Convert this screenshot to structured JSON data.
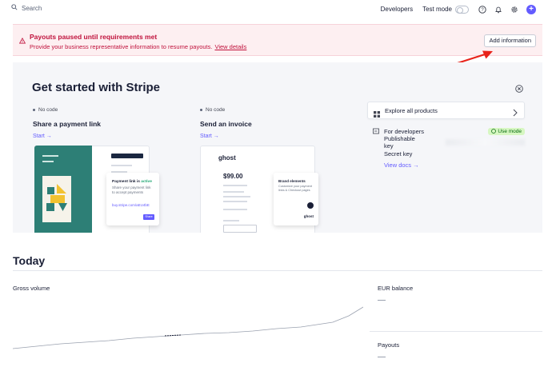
{
  "nav": {
    "search_placeholder": "Search",
    "developers": "Developers",
    "test_mode": "Test mode"
  },
  "alert": {
    "title": "Payouts paused until requirements met",
    "description": "Provide your business representative information to resume payouts.",
    "link": "View details",
    "button": "Add information"
  },
  "get_started": {
    "title": "Get started with Stripe",
    "cards": [
      {
        "tag": "No code",
        "title": "Share a payment link",
        "cta": "Start →"
      },
      {
        "tag": "No code",
        "title": "Send an invoice",
        "cta": "Start →"
      }
    ],
    "illus1": {
      "popup_title": "Payment link is",
      "popup_status": "active",
      "popup_text": "Share your payment link to accept payments",
      "popup_url": "buy.stripe.com/aEU4bE",
      "popup_btn": "Share"
    },
    "illus2": {
      "logo": "ghost",
      "amount": "$99.00",
      "popup_title": "Brand elements",
      "popup_text": "Customize your payment links & Checkout pages",
      "popup_logo": "ghost"
    },
    "explore": "Explore all products",
    "developers": {
      "label": "For developers",
      "badge": "Use mode",
      "publishable_key": "Publishable key",
      "secret_key": "Secret key",
      "docs": "View docs →"
    }
  },
  "today": {
    "title": "Today",
    "gross_volume": "Gross volume",
    "eur_balance": "EUR balance",
    "payouts": "Payouts"
  },
  "colors": {
    "accent": "#635bff",
    "alert_bg": "#fdeff1",
    "alert_text": "#c0123c",
    "arrow": "#e8231a"
  }
}
